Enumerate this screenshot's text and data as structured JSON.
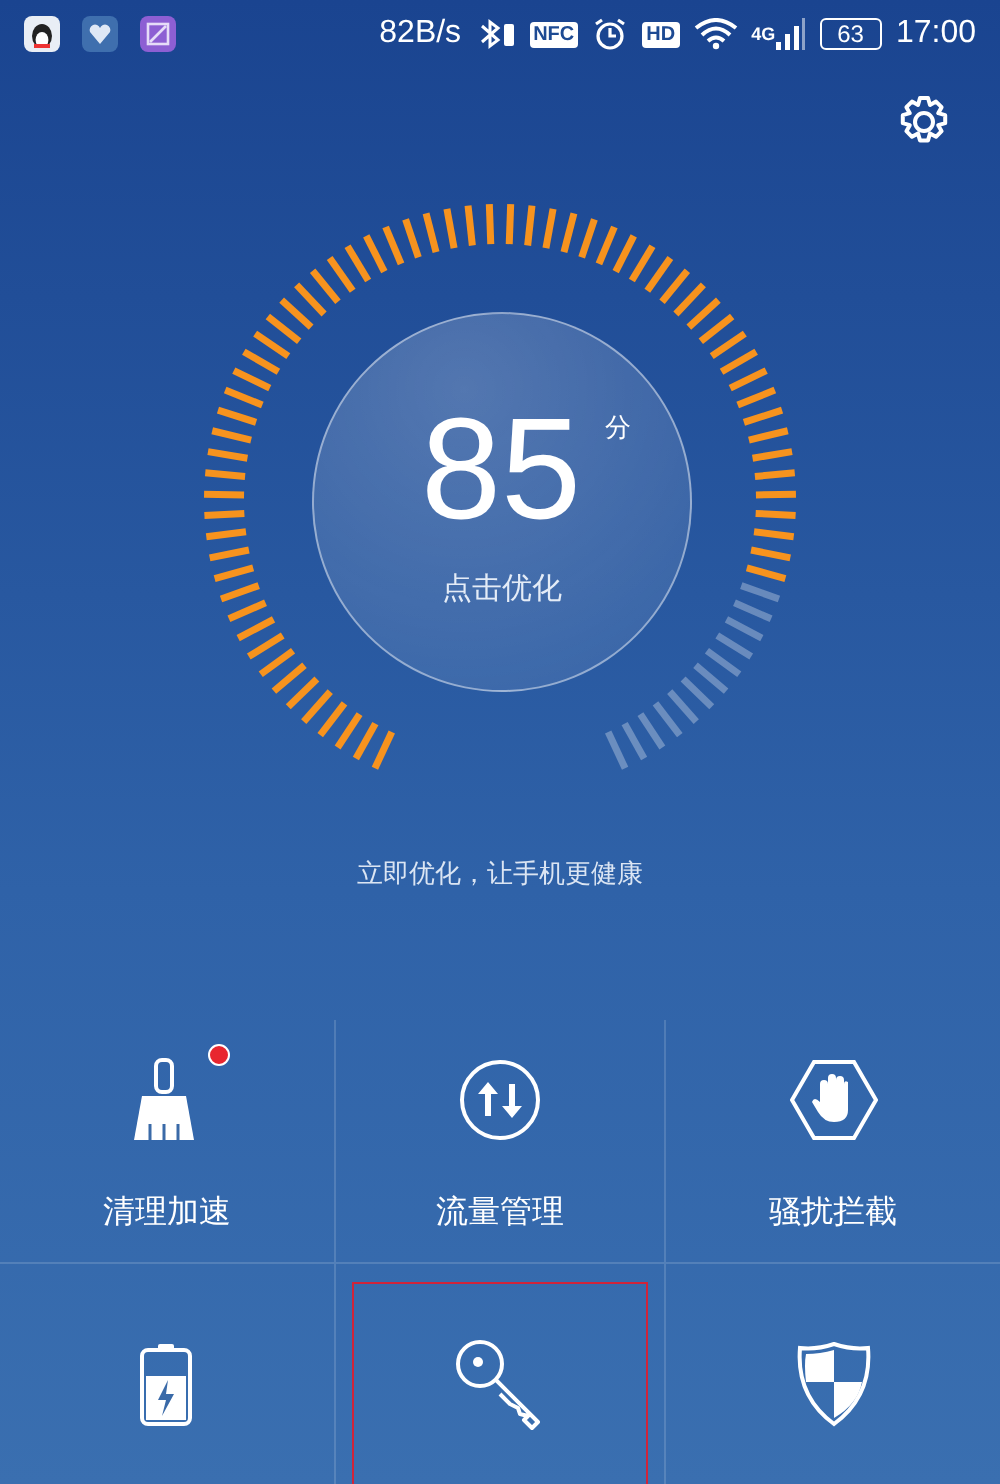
{
  "status_bar": {
    "speed": "82B/s",
    "nfc": "NFC",
    "hd": "HD",
    "network": "4G",
    "battery": "63",
    "time": "17:00"
  },
  "score": {
    "value": "85",
    "unit": "分",
    "action": "点击优化"
  },
  "tagline": "立即优化，让手机更健康",
  "tiles": [
    {
      "kind": "broom",
      "label": "清理加速",
      "badge": true,
      "selected": false
    },
    {
      "kind": "transfer",
      "label": "流量管理",
      "badge": false,
      "selected": false
    },
    {
      "kind": "hand",
      "label": "骚扰拦截",
      "badge": false,
      "selected": false
    },
    {
      "kind": "battery",
      "badge": false,
      "selected": false
    },
    {
      "kind": "key",
      "badge": false,
      "selected": true
    },
    {
      "kind": "shield",
      "badge": false,
      "selected": false
    }
  ]
}
